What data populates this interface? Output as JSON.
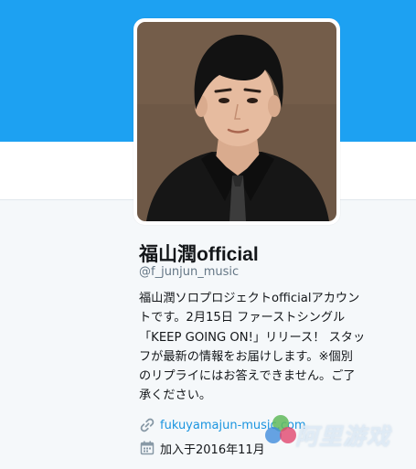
{
  "profile": {
    "display_name": "福山潤official",
    "screen_name": "@f_junjun_music",
    "bio_lines": [
      "福山潤ソロプロジェクトofficialアカウン",
      "トです。2月15日 ファーストシングル",
      "「KEEP GOING ON!」リリース！ スタッ",
      "フが最新の情報をお届けします。※個別",
      "のリプライにはお答えできません。ご了",
      "承ください。"
    ],
    "url": "fukuyamajun-music.com",
    "joined": "加入于2016年11月"
  },
  "icons": {
    "url": "link-icon",
    "joined": "calendar-icon"
  },
  "watermark": {
    "text": "阿里游戏"
  },
  "colors": {
    "header": "#1da1f2",
    "link": "#1b95e0",
    "page": "#f5f8fa"
  }
}
